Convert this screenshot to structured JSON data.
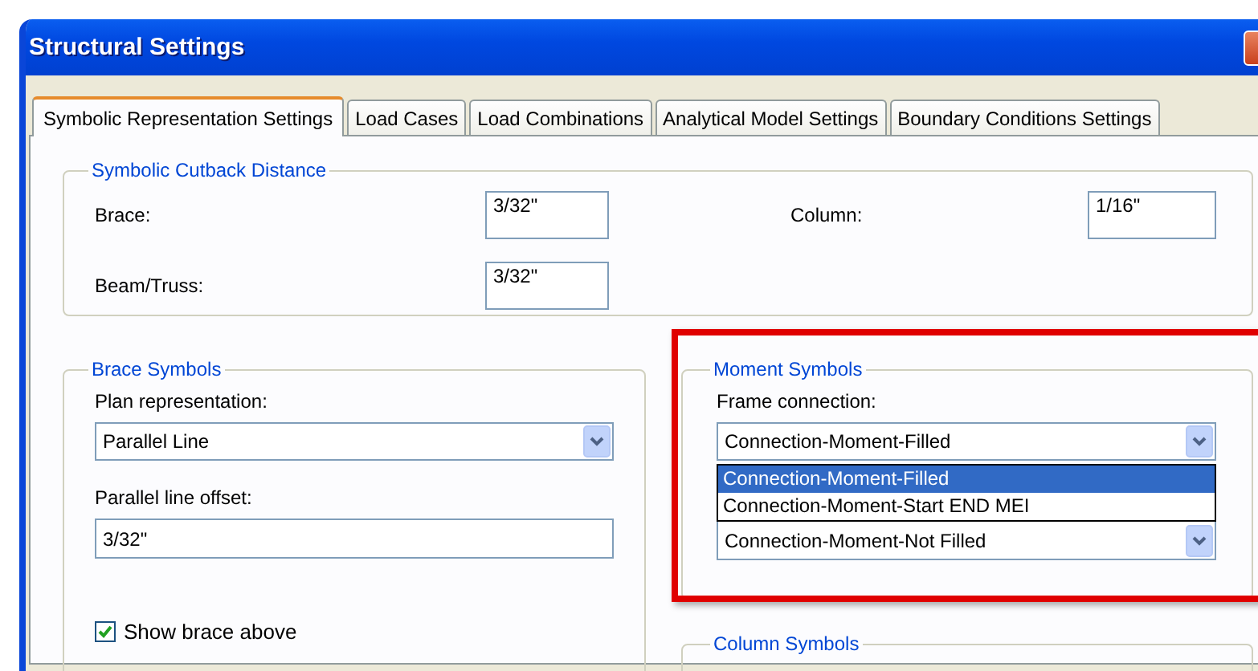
{
  "window": {
    "title": "Structural Settings"
  },
  "tabs": [
    {
      "label": "Symbolic Representation Settings",
      "selected": true
    },
    {
      "label": "Load Cases",
      "selected": false
    },
    {
      "label": "Load Combinations",
      "selected": false
    },
    {
      "label": "Analytical Model Settings",
      "selected": false
    },
    {
      "label": "Boundary Conditions Settings",
      "selected": false
    }
  ],
  "cutback": {
    "title": "Symbolic Cutback Distance",
    "fields": [
      {
        "label": "Brace:",
        "value": "3/32\""
      },
      {
        "label": "Column:",
        "value": "1/16\""
      },
      {
        "label": "Beam/Truss:",
        "value": "3/32\""
      }
    ]
  },
  "brace_symbols": {
    "title": "Brace Symbols",
    "plan_label": "Plan representation:",
    "plan_value": "Parallel Line",
    "offset_label": "Parallel line offset:",
    "offset_value": "3/32\"",
    "show_brace_above": {
      "label": "Show brace above",
      "checked": true
    }
  },
  "moment_symbols": {
    "title": "Moment Symbols",
    "highlighted": true,
    "frame_label": "Frame connection:",
    "frame_value": "Connection-Moment-Filled",
    "options": [
      {
        "label": "Connection-Moment-Filled",
        "selected": true
      },
      {
        "label": "Connection-Moment-Start END MEI",
        "selected": false
      }
    ],
    "second_value": "Connection-Moment-Not Filled"
  },
  "column_symbols": {
    "title": "Column Symbols"
  }
}
